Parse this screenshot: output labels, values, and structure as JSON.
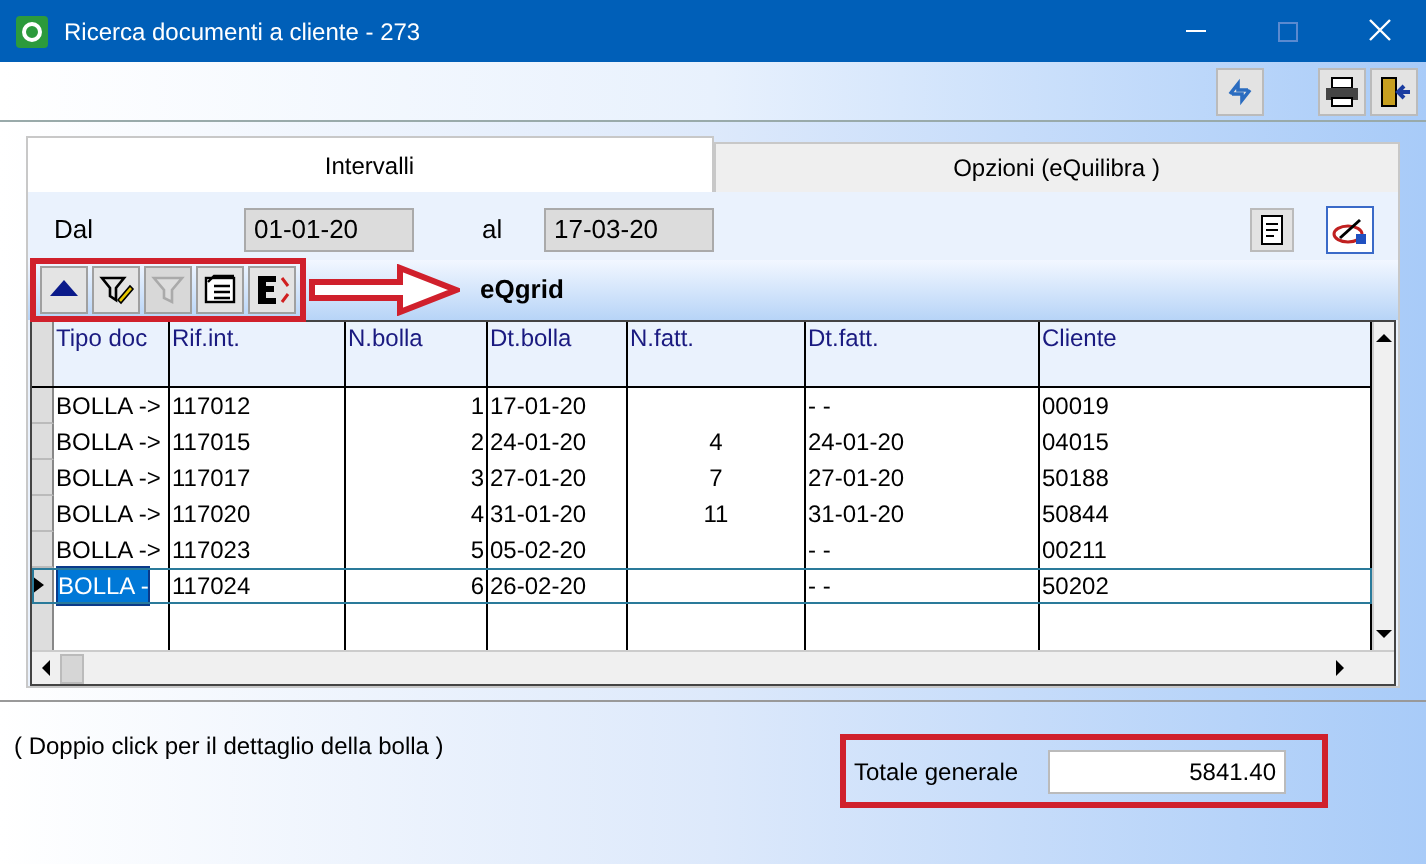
{
  "window": {
    "title": "Ricerca documenti a cliente - 273"
  },
  "tabs": [
    {
      "label": "Intervalli",
      "selected": true
    },
    {
      "label": "Opzioni (eQuilibra )",
      "selected": false
    }
  ],
  "filters": {
    "from_label": "Dal",
    "from_value": "01-01-20",
    "to_label": "al",
    "to_value": "17-03-20"
  },
  "grid": {
    "title": "eQgrid",
    "toolbar": [
      {
        "kind": "up",
        "disabled": false
      },
      {
        "kind": "filter-edit",
        "disabled": false
      },
      {
        "kind": "filter",
        "disabled": true
      },
      {
        "kind": "list",
        "disabled": false
      },
      {
        "kind": "export",
        "disabled": false
      }
    ],
    "columns": [
      "Tipo doc",
      "Rif.int.",
      "N.bolla",
      "Dt.bolla",
      "N.fatt.",
      "Dt.fatt.",
      "Cliente"
    ],
    "rows": [
      {
        "cells": [
          "BOLLA ->",
          "117012",
          "1",
          "17-01-20",
          "",
          "- -",
          "00019"
        ],
        "selected": false
      },
      {
        "cells": [
          "BOLLA ->",
          "117015",
          "2",
          "24-01-20",
          "4",
          "24-01-20",
          "04015"
        ],
        "selected": false
      },
      {
        "cells": [
          "BOLLA ->",
          "117017",
          "3",
          "27-01-20",
          "7",
          "27-01-20",
          "50188"
        ],
        "selected": false
      },
      {
        "cells": [
          "BOLLA ->",
          "117020",
          "4",
          "31-01-20",
          "11",
          "31-01-20",
          "50844"
        ],
        "selected": false
      },
      {
        "cells": [
          "BOLLA ->",
          "117023",
          "5",
          "05-02-20",
          "",
          "- -",
          "00211"
        ],
        "selected": false
      },
      {
        "cells": [
          "BOLLA -",
          "117024",
          "6",
          "26-02-20",
          "",
          "- -",
          "50202"
        ],
        "selected": true
      }
    ]
  },
  "hint": "( Doppio click per il dettaglio della bolla )",
  "total": {
    "label": "Totale generale",
    "value": "5841.40"
  }
}
